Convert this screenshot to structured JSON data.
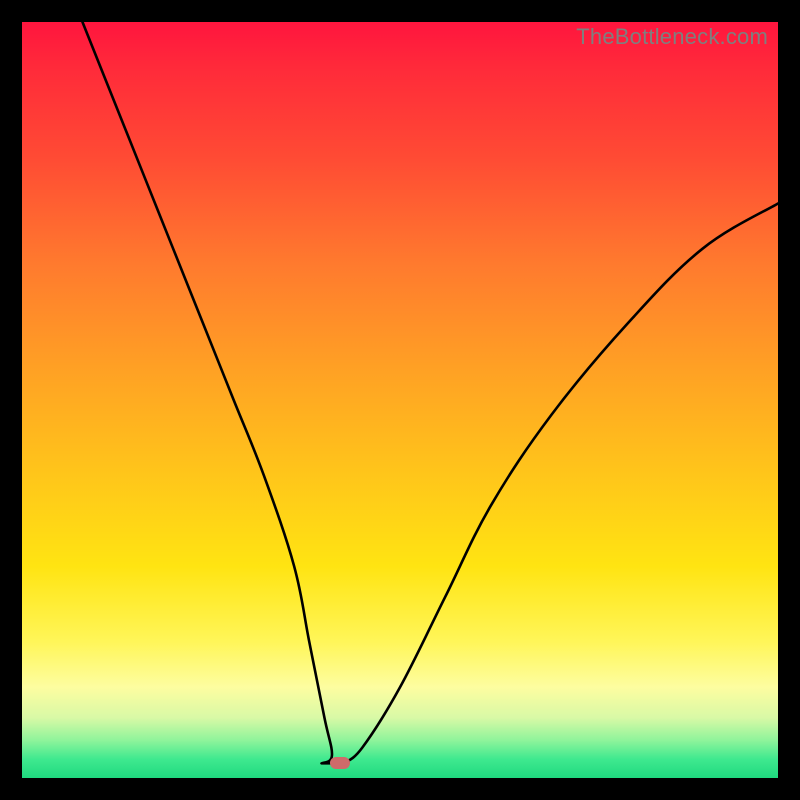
{
  "watermark": "TheBottleneck.com",
  "colors": {
    "frame": "#000000",
    "curve": "#000000",
    "marker": "#cf6a6a",
    "watermark": "#7f7f7f"
  },
  "chart_data": {
    "type": "line",
    "title": "",
    "xlabel": "",
    "ylabel": "",
    "xlim": [
      0,
      100
    ],
    "ylim": [
      0,
      100
    ],
    "grid": false,
    "legend": false,
    "series": [
      {
        "name": "bottleneck-curve",
        "x": [
          8,
          12,
          16,
          20,
          24,
          28,
          32,
          36,
          38,
          40,
          41,
          42,
          45,
          50,
          56,
          62,
          70,
          80,
          90,
          100
        ],
        "values": [
          100,
          90,
          80,
          70,
          60,
          50,
          40,
          28,
          18,
          8,
          3,
          2,
          4,
          12,
          24,
          36,
          48,
          60,
          70,
          76
        ]
      }
    ],
    "annotations": [
      {
        "name": "min-marker",
        "x": 42,
        "y": 2,
        "kind": "rounded-rect"
      }
    ]
  }
}
